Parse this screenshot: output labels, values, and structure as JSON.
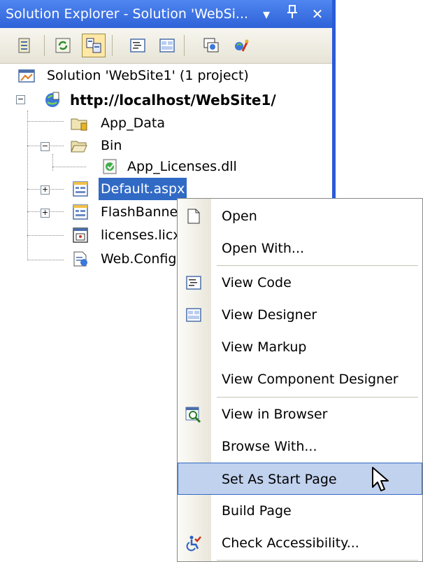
{
  "titlebar": {
    "title": "Solution Explorer - Solution 'WebSi...",
    "dropdown_glyph": "▾",
    "pin_glyph": "ᅮ",
    "close_glyph": "✕"
  },
  "toolbar": {
    "buttons": [
      "properties-icon",
      "refresh-icon",
      "nest-related-files-icon",
      "view-code-icon",
      "view-designer-icon",
      "copy-web-site-icon",
      "asp-net-configuration-icon"
    ],
    "active": "nest-related-files-icon"
  },
  "tree": {
    "solution": "Solution 'WebSite1' (1 project)",
    "project": "http://localhost/WebSite1/",
    "app_data": "App_Data",
    "bin": "Bin",
    "dll": "App_Licenses.dll",
    "default": "Default.aspx",
    "flash": "FlashBanne",
    "licenses": "licenses.licx",
    "webconfig": "Web.Config",
    "expand_minus": "−",
    "expand_plus": "+"
  },
  "menu": {
    "items": [
      "Open",
      "Open With...",
      "View Code",
      "View Designer",
      "View Markup",
      "View Component Designer",
      "View in Browser",
      "Browse With...",
      "Set As Start Page",
      "Build Page",
      "Check Accessibility..."
    ],
    "highlighted": "Set As Start Page"
  },
  "colors": {
    "titlebar": "#2e62d8",
    "selection": "#316ac5",
    "menu_highlight": "#c1d2ee"
  }
}
